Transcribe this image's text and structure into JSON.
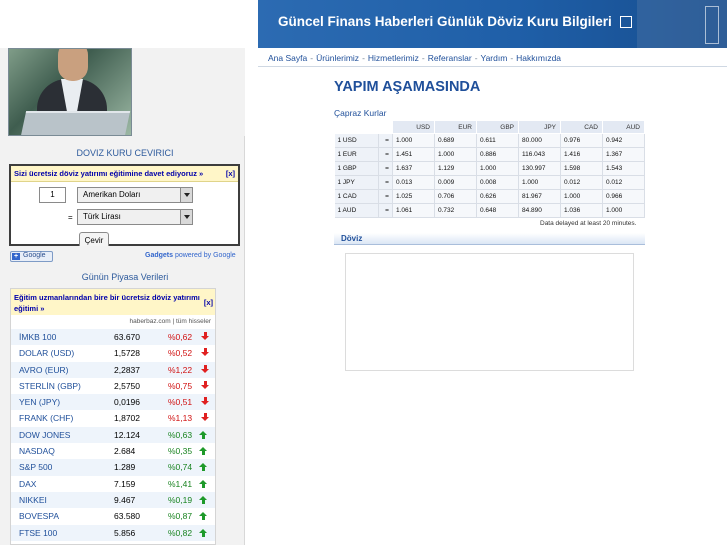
{
  "header": {
    "title": "Güncel Finans Haberleri Günlük Döviz Kuru Bilgileri"
  },
  "nav": {
    "items": [
      "Ana Sayfa",
      "Ürünlerimiz",
      "Hizmetlerimiz",
      "Referanslar",
      "Yardım",
      "Hakkımızda"
    ],
    "separator": "-"
  },
  "main": {
    "title": "YAPIM AŞAMASINDA",
    "cross_rates_label": "Çapraz Kurlar",
    "delayed_note": "Data delayed at least 20 minutes.",
    "doviz_label": "Döviz"
  },
  "rates_table": {
    "headers": [
      "",
      "",
      "USD",
      "EUR",
      "GBP",
      "JPY",
      "CAD",
      "AUD"
    ],
    "rows": [
      [
        "1 USD",
        "=",
        "1.000",
        "0.689",
        "0.611",
        "80.000",
        "0.976",
        "0.942"
      ],
      [
        "1 EUR",
        "=",
        "1.451",
        "1.000",
        "0.886",
        "116.043",
        "1.416",
        "1.367"
      ],
      [
        "1 GBP",
        "=",
        "1.637",
        "1.129",
        "1.000",
        "130.997",
        "1.598",
        "1.543"
      ],
      [
        "1 JPY",
        "=",
        "0.013",
        "0.009",
        "0.008",
        "1.000",
        "0.012",
        "0.012"
      ],
      [
        "1 CAD",
        "=",
        "1.025",
        "0.706",
        "0.626",
        "81.967",
        "1.000",
        "0.966"
      ],
      [
        "1 AUD",
        "=",
        "1.061",
        "0.732",
        "0.648",
        "84.890",
        "1.036",
        "1.000"
      ]
    ]
  },
  "converter": {
    "title": "DOVIZ KURU CEVIRICI",
    "banner": "Sizi ücretsiz döviz yatırımı eğitimine davet ediyoruz »",
    "close": "[x]",
    "amount": "1",
    "from_currency": "Amerikan Doları",
    "equals": "=",
    "to_currency": "Türk Lirası",
    "button": "Çevir"
  },
  "google": {
    "button": "Google",
    "plus": "+",
    "gadgets_text": "Gadgets",
    "powered_by": "powered by Google"
  },
  "market": {
    "title": "Günün Piyasa Verileri",
    "banner": "Eğitim uzmanlarından bire bir ücretsiz döviz yatırımı eğitimi »",
    "close": "[x]",
    "links": "haberbaz.com | tüm hisseler",
    "rows": [
      {
        "name": "İMKB 100",
        "value": "63.670",
        "change": "%0,62",
        "dir": "down"
      },
      {
        "name": "DOLAR (USD)",
        "value": "1,5728",
        "change": "%0,52",
        "dir": "down"
      },
      {
        "name": "AVRO (EUR)",
        "value": "2,2837",
        "change": "%1,22",
        "dir": "down"
      },
      {
        "name": "STERLİN (GBP)",
        "value": "2,5750",
        "change": "%0,75",
        "dir": "down"
      },
      {
        "name": "YEN (JPY)",
        "value": "0,0196",
        "change": "%0,51",
        "dir": "down"
      },
      {
        "name": "FRANK (CHF)",
        "value": "1,8702",
        "change": "%1,13",
        "dir": "down"
      },
      {
        "name": "DOW JONES",
        "value": "12.124",
        "change": "%0,63",
        "dir": "up"
      },
      {
        "name": "NASDAQ",
        "value": "2.684",
        "change": "%0,35",
        "dir": "up"
      },
      {
        "name": "S&P 500",
        "value": "1.289",
        "change": "%0,74",
        "dir": "up"
      },
      {
        "name": "DAX",
        "value": "7.159",
        "change": "%1,41",
        "dir": "up"
      },
      {
        "name": "NIKKEI",
        "value": "9.467",
        "change": "%0,19",
        "dir": "up"
      },
      {
        "name": "BOVESPA",
        "value": "63.580",
        "change": "%0,87",
        "dir": "up"
      },
      {
        "name": "FTSE 100",
        "value": "5.856",
        "change": "%0,82",
        "dir": "up"
      }
    ]
  }
}
